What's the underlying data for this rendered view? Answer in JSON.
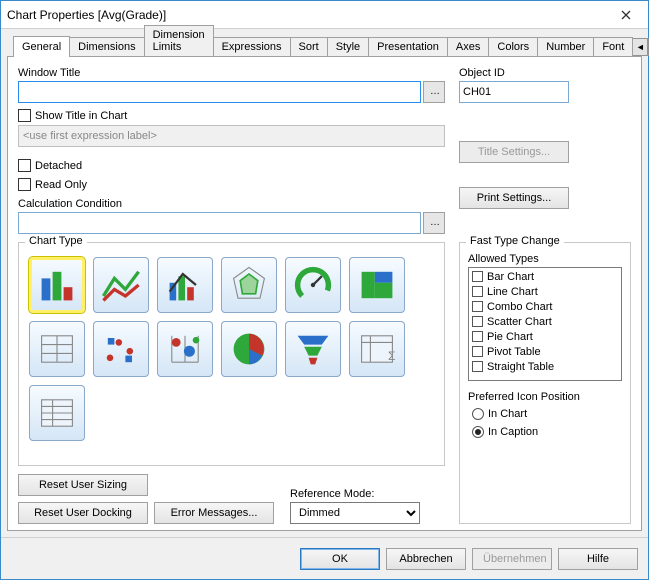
{
  "titlebar": {
    "title": "Chart Properties [Avg(Grade)]"
  },
  "tabs": {
    "items": [
      "General",
      "Dimensions",
      "Dimension Limits",
      "Expressions",
      "Sort",
      "Style",
      "Presentation",
      "Axes",
      "Colors",
      "Number",
      "Font"
    ],
    "active": "General"
  },
  "left": {
    "windowTitleLabel": "Window Title",
    "windowTitleValue": "",
    "showTitleLabel": "Show Title in Chart",
    "expressionPlaceholder": "<use first expression label>",
    "detachedLabel": "Detached",
    "readOnlyLabel": "Read Only",
    "calcCondLabel": "Calculation Condition",
    "calcCondValue": ""
  },
  "right": {
    "objectIdLabel": "Object ID",
    "objectIdValue": "CH01",
    "titleSettingsBtn": "Title Settings...",
    "printSettingsBtn": "Print Settings..."
  },
  "chartType": {
    "panelTitle": "Chart Type",
    "items": [
      {
        "name": "bar",
        "selected": true
      },
      {
        "name": "line",
        "selected": false
      },
      {
        "name": "combo",
        "selected": false
      },
      {
        "name": "radar",
        "selected": false
      },
      {
        "name": "gauge",
        "selected": false
      },
      {
        "name": "mekko",
        "selected": false
      },
      {
        "name": "block",
        "selected": false
      },
      {
        "name": "scatter",
        "selected": false
      },
      {
        "name": "grid",
        "selected": false
      },
      {
        "name": "pie",
        "selected": false
      },
      {
        "name": "funnel",
        "selected": false
      },
      {
        "name": "pivot",
        "selected": false
      },
      {
        "name": "straight",
        "selected": false
      }
    ]
  },
  "fastType": {
    "panelTitle": "Fast Type Change",
    "allowedLabel": "Allowed Types",
    "items": [
      "Bar Chart",
      "Line Chart",
      "Combo Chart",
      "Scatter Chart",
      "Pie Chart",
      "Pivot Table",
      "Straight Table"
    ],
    "prefIconLabel": "Preferred Icon Position",
    "radioInChart": "In Chart",
    "radioInCaption": "In Caption",
    "selected": "In Caption"
  },
  "buttons": {
    "resetSizing": "Reset User Sizing",
    "resetDocking": "Reset User Docking",
    "errorMessages": "Error Messages...",
    "referenceModeLabel": "Reference Mode:",
    "referenceModeValue": "Dimmed"
  },
  "footer": {
    "ok": "OK",
    "cancel": "Abbrechen",
    "apply": "Übernehmen",
    "help": "Hilfe"
  }
}
